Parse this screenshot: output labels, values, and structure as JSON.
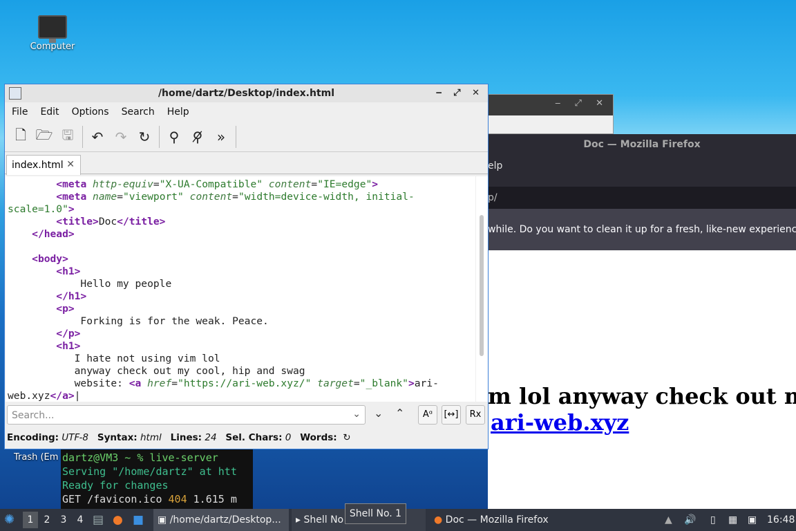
{
  "desktop": {
    "computer_label": "Computer",
    "trash_label": "Trash (Em"
  },
  "firefox": {
    "title": "Doc — Mozilla Firefox",
    "menu_partial": "elp",
    "url_partial": "p/",
    "notification_partial": "while. Do you want to clean it up for a fresh, like-new experience? A",
    "content_line1": "m lol anyway check out m",
    "content_link": "ari-web.xyz"
  },
  "terminal": {
    "prompt": "dartz@VM3 ~ % live-server",
    "serving": "Serving \"/home/dartz\" at htt",
    "ready": "Ready for changes",
    "get_prefix": "GET /favicon.ico ",
    "get_status": "404",
    "get_suffix": " 1.615 m"
  },
  "editor": {
    "title": "/home/dartz/Desktop/index.html",
    "menu": [
      "File",
      "Edit",
      "Options",
      "Search",
      "Help"
    ],
    "tab_label": "index.html",
    "search_placeholder": "Search...",
    "find_buttons": {
      "case": "Aᵅ",
      "whole": "[↔]",
      "regex": "Rx"
    },
    "status": {
      "encoding_label": "Encoding:",
      "encoding": "UTF-8",
      "syntax_label": "Syntax:",
      "syntax": "html",
      "lines_label": "Lines:",
      "lines": "24",
      "sel_label": "Sel. Chars:",
      "sel": "0",
      "words_label": "Words:"
    }
  },
  "taskbar": {
    "workspaces": [
      "1",
      "2",
      "3",
      "4"
    ],
    "editor_task": "/home/dartz/Desktop...",
    "shell_task": "Shell No",
    "firefox_task": "Doc — Mozilla Firefox",
    "tooltip": "Shell No. 1",
    "clock": "16:48"
  },
  "colors": {
    "tag": "#7a1fa2",
    "attr": "#3d7a3d",
    "string": "#2c7a2c",
    "accent": "#3b7fd6"
  }
}
